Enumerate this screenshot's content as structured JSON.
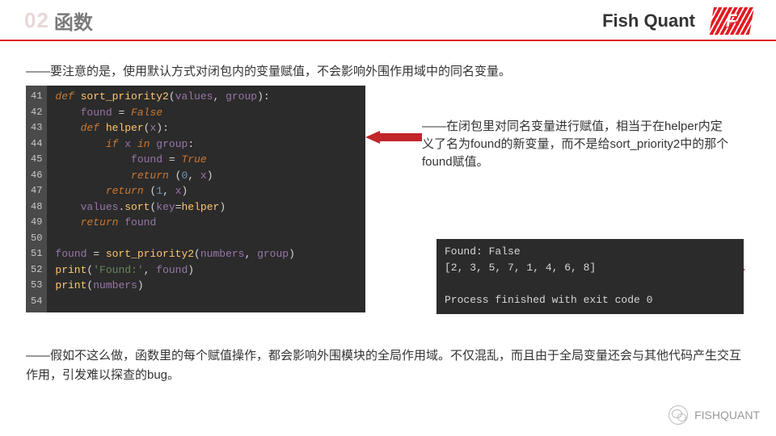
{
  "header": {
    "chapter_num": "02",
    "chapter_title": "函数",
    "brand_text": "Fish Quant",
    "brand_letter": "F"
  },
  "note1": "——要注意的是，使用默认方式对闭包内的变量赋值，不会影响外围作用域中的同名变量。",
  "code": {
    "line_start": 41,
    "line_end": 54,
    "lines": [
      "def sort_priority2(values, group):",
      "    found = False",
      "    def helper(x):",
      "        if x in group:",
      "            found = True",
      "            return (0, x)",
      "        return (1, x)",
      "    values.sort(key=helper)",
      "    return found",
      "",
      "found = sort_priority2(numbers, group)",
      "print('Found:', found)",
      "print(numbers)",
      ""
    ]
  },
  "annotation": "——在闭包里对同名变量进行赋值，相当于在helper内定义了名为found的新变量，而不是给sort_priority2中的那个found赋值。",
  "output": "Found: False\n[2, 3, 5, 7, 1, 4, 6, 8]\n\nProcess finished with exit code 0",
  "note2": "——假如不这么做，函数里的每个赋值操作，都会影响外围模块的全局作用域。不仅混乱，而且由于全局变量还会与其他代码产生交互作用，引发难以探查的bug。",
  "watermark": "FISHQUANT"
}
